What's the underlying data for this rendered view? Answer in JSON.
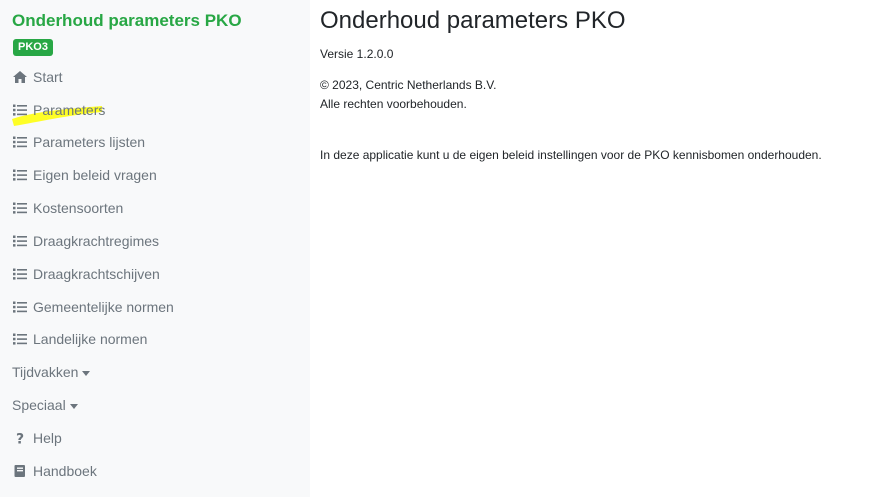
{
  "sidebar": {
    "brand": "Onderhoud parameters PKO",
    "badge": "PKO3",
    "items": [
      {
        "label": "Start",
        "icon": "home-icon"
      },
      {
        "label": "Parameters",
        "icon": "list-icon"
      },
      {
        "label": "Parameters lijsten",
        "icon": "list-icon"
      },
      {
        "label": "Eigen beleid vragen",
        "icon": "list-icon"
      },
      {
        "label": "Kostensoorten",
        "icon": "list-icon"
      },
      {
        "label": "Draagkrachtregimes",
        "icon": "list-icon"
      },
      {
        "label": "Draagkrachtschijven",
        "icon": "list-icon"
      },
      {
        "label": "Gemeentelijke normen",
        "icon": "list-icon"
      },
      {
        "label": "Landelijke normen",
        "icon": "list-icon"
      },
      {
        "label": "Tijdvakken",
        "icon": "caret-down-icon"
      },
      {
        "label": "Speciaal",
        "icon": "caret-down-icon"
      },
      {
        "label": "Help",
        "icon": "question-icon"
      },
      {
        "label": "Handboek",
        "icon": "book-icon"
      }
    ]
  },
  "main": {
    "title": "Onderhoud parameters PKO",
    "version": "Versie 1.2.0.0",
    "copyright": "© 2023, Centric Netherlands B.V.",
    "rights": "Alle rechten voorbehouden.",
    "description": "In deze applicatie kunt u de eigen beleid instellingen voor de PKO kennisbomen onderhouden."
  },
  "colors": {
    "brand": "#28a745",
    "nav_text": "#6c757d",
    "sidebar_bg": "#f8f9fa",
    "highlight": "#ffff00"
  }
}
